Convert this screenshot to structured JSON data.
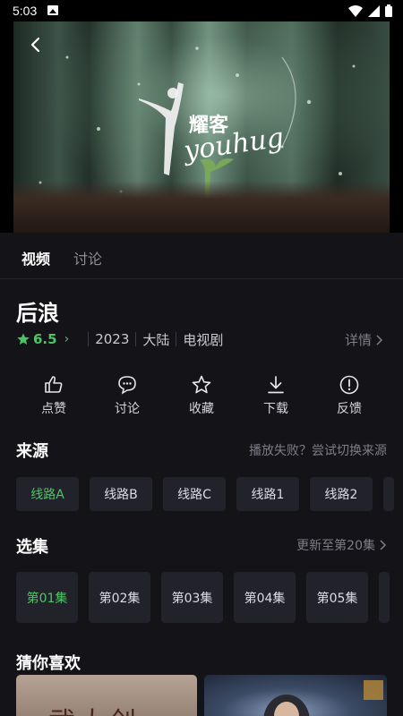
{
  "status_bar": {
    "time": "5:03",
    "icons": [
      "gallery-icon",
      "wifi-icon",
      "signal-icon",
      "battery-icon"
    ]
  },
  "video": {
    "overlay_text": "耀客",
    "overlay_script": "youhug",
    "back_icon": "back-arrow-icon"
  },
  "tabs": [
    {
      "label": "视频",
      "active": true
    },
    {
      "label": "讨论",
      "active": false
    }
  ],
  "show": {
    "title": "后浪",
    "rating": "6.5",
    "year": "2023",
    "region": "大陆",
    "category": "电视剧",
    "details_label": "详情"
  },
  "actions": [
    {
      "label": "点赞",
      "icon": "thumbs-up-icon"
    },
    {
      "label": "讨论",
      "icon": "chat-bubble-icon"
    },
    {
      "label": "收藏",
      "icon": "star-outline-icon"
    },
    {
      "label": "下载",
      "icon": "download-icon"
    },
    {
      "label": "反馈",
      "icon": "alert-circle-icon"
    }
  ],
  "source": {
    "title": "来源",
    "hint": "播放失败？尝试切换来源",
    "lines": [
      "线路A",
      "线路B",
      "线路C",
      "线路1",
      "线路2"
    ],
    "selected_index": 0
  },
  "episodes": {
    "title": "选集",
    "hint": "更新至第20集",
    "items": [
      "第01集",
      "第02集",
      "第03集",
      "第04集",
      "第05集"
    ],
    "selected_index": 0
  },
  "recommend": {
    "title": "猜你喜欢",
    "poster_text": "武大创"
  },
  "colors": {
    "accent": "#4cc566",
    "background": "#141418",
    "chip": "#22232a"
  }
}
